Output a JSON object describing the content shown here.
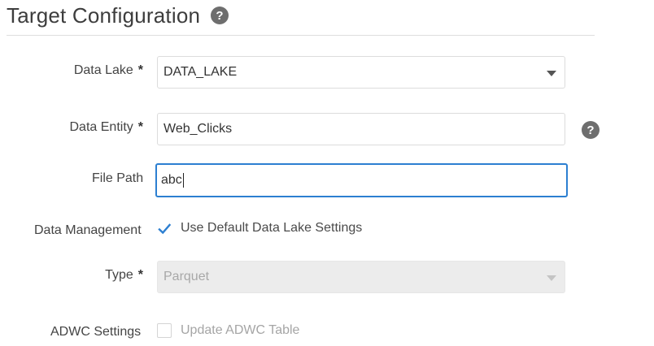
{
  "header": {
    "title": "Target Configuration"
  },
  "form": {
    "data_lake": {
      "label": "Data Lake",
      "required_marker": "*",
      "value": "DATA_LAKE"
    },
    "data_entity": {
      "label": "Data Entity",
      "required_marker": "*",
      "value": "Web_Clicks"
    },
    "file_path": {
      "label": "File Path",
      "value": "abc"
    },
    "data_management": {
      "label": "Data Management",
      "checkbox_label": "Use Default Data Lake Settings",
      "checked": true
    },
    "type": {
      "label": "Type",
      "required_marker": "*",
      "value": "Parquet",
      "disabled": true
    },
    "adwc_settings": {
      "label": "ADWC Settings",
      "checkbox_label": "Update ADWC Table",
      "checked": false,
      "disabled": true
    }
  },
  "icons": {
    "title_help": "help-circle-icon",
    "entity_help": "help-circle-icon",
    "dropdown": "chevron-down-icon",
    "checkmark": "check-icon"
  },
  "colors": {
    "focus_border": "#2c7fd1",
    "checkbox_check": "#2c7fd1",
    "help_icon": "#6e6e6e"
  }
}
